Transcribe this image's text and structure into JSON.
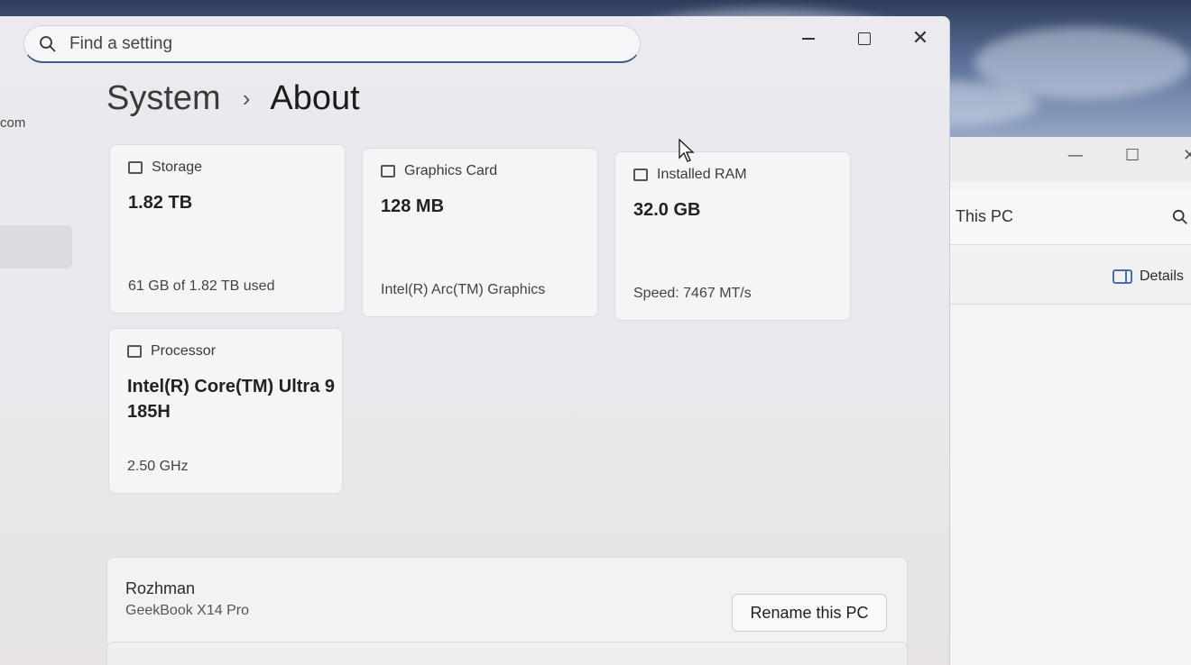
{
  "search": {
    "placeholder": "Find a setting"
  },
  "sidebar": {
    "partial_text": "com"
  },
  "breadcrumb": {
    "parent": "System",
    "separator": "›",
    "current": "About"
  },
  "specs": {
    "storage": {
      "label": "Storage",
      "value": "1.82 TB",
      "detail": "61 GB of 1.82 TB used"
    },
    "graphics": {
      "label": "Graphics Card",
      "value": "128 MB",
      "detail": "Intel(R) Arc(TM) Graphics"
    },
    "ram": {
      "label": "Installed RAM",
      "value": "32.0 GB",
      "detail": "Speed: 7467 MT/s"
    },
    "processor": {
      "label": "Processor",
      "value": "Intel(R) Core(TM) Ultra 9 185H",
      "detail": "2.50 GHz"
    }
  },
  "device": {
    "name": "Rozhman",
    "model": "GeekBook X14 Pro",
    "rename_label": "Rename this PC"
  },
  "explorer": {
    "address": "This PC",
    "details_label": "Details"
  },
  "colors": {
    "search_underline": "#3d5a8a",
    "window_bg": "#ebebef",
    "card_bg": "#f5f4f6"
  }
}
